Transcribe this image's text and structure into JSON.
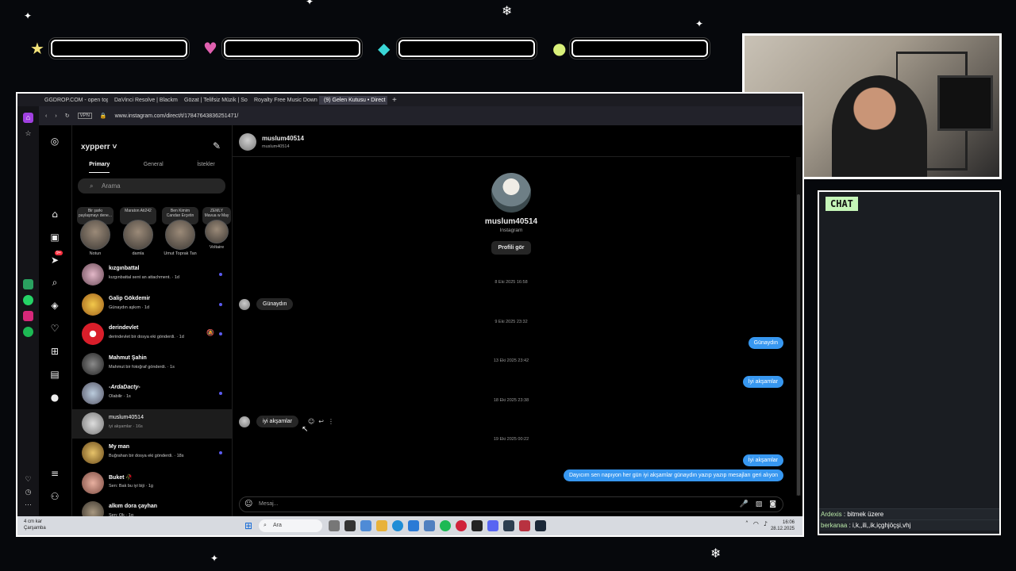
{
  "overlay": {
    "chat_title": "CHAT",
    "chat_messages": [
      {
        "user": "Ardexis",
        "text": "bitmek üzere"
      },
      {
        "user": "berkanaa",
        "text": "i,k,,ili,,ik,içghjöçşi,vhj"
      }
    ],
    "hud_icons": [
      "star-icon",
      "heart-icon",
      "diamond-icon",
      "coin-icon"
    ]
  },
  "browser": {
    "tabs": [
      {
        "label": "GGDROP.COM - open top",
        "active": false
      },
      {
        "label": "DaVinci Resolve | Blackma",
        "active": false
      },
      {
        "label": "Gözat | Telifsiz Müzik | So",
        "active": false
      },
      {
        "label": "Royalty Free Music Down",
        "active": false
      },
      {
        "label": "(9) Gelen Kutusu • Direct",
        "active": true
      }
    ],
    "new_tab": "+",
    "vpn": "VPN",
    "url": "www.instagram.com/direct/t/17847643836251471/",
    "sidebar_badge": "9+"
  },
  "inbox": {
    "username": "xypperr",
    "tabs": [
      "Primary",
      "General",
      "İstekler"
    ],
    "search_placeholder": "Arama",
    "notes": [
      {
        "bubble": "Bir şarkı paylaşmayı dene...",
        "name": "Notun"
      },
      {
        "bubble": "Maraton Ati242",
        "name": "damla"
      },
      {
        "bubble": "Ben Kimim Candan Erçetin",
        "name": "Umut Toprak Tan"
      },
      {
        "bubble": "ZEMLY Mavua w May",
        "name": "Voltaire"
      }
    ],
    "conversations": [
      {
        "name": "kızgınbattal",
        "preview": "kızgınbattal sent an attachment. · 1d",
        "unread": true
      },
      {
        "name": "Galip Gökdemir",
        "preview": "Günaydın aşkım · 1d",
        "unread": true
      },
      {
        "name": "derindevlet",
        "preview": "derindevlet bir dosya eki gönderdi. · 1d",
        "unread": true
      },
      {
        "name": "Mahmut Şahin",
        "preview": "Mahmut bir fotoğraf gönderdi. · 1s",
        "unread": false
      },
      {
        "name": "-ArdaDacty-",
        "preview": "Olabilir · 1s",
        "unread": true
      },
      {
        "name": "muslum40514",
        "preview": "iyi akşamlar · 16s",
        "unread": false
      },
      {
        "name": "My man",
        "preview": "Buğrahan bir dosya eki gönderdi. · 18s",
        "unread": true
      },
      {
        "name": "Buket 🥀",
        "preview": "Sen: Bak bu iyi biji · 1g",
        "unread": false
      },
      {
        "name": "alkım dora çayhan",
        "preview": "Sen: Ok · 1g",
        "unread": false
      }
    ]
  },
  "thread": {
    "name": "muslum40514",
    "sub": "muslum40514",
    "profile_name": "muslum40514",
    "profile_sub": "Instagram",
    "profile_button": "Profili gör",
    "timestamps": [
      "8 Eki 2025 16:58",
      "9 Eki 2025 23:32",
      "13 Eki 2025 23:42",
      "18 Eki 2025 23:38",
      "19 Eki 2025 00:22"
    ],
    "msg_in_1": "Günaydın",
    "msg_out_1": "Günaydın",
    "msg_out_2": "İyi akşamlar",
    "msg_in_2": "iyi akşamlar",
    "msg_out_3": "İyi akşamlar",
    "msg_out_4": "Dayıcım sen napıyon her gün iyi akşamlar günaydın yazıp yazıp mesajları geri alıyon",
    "composer_placeholder": "Mesaj..."
  },
  "taskbar": {
    "weather_line1": "4 cm kar",
    "weather_line2": "Çarşamba",
    "search": "Ara",
    "time": "16:06",
    "date": "28.12.2025"
  }
}
